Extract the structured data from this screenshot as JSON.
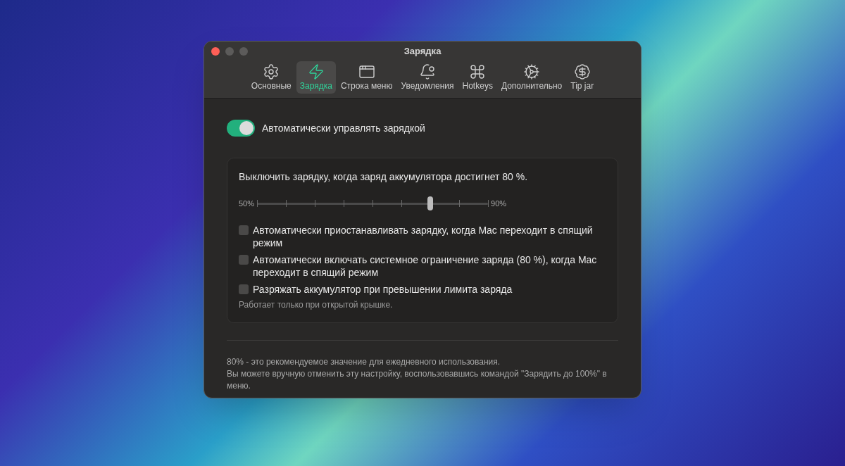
{
  "window": {
    "title": "Зарядка"
  },
  "tabs": [
    {
      "label": "Основные",
      "selected": false
    },
    {
      "label": "Зарядка",
      "selected": true
    },
    {
      "label": "Строка меню",
      "selected": false
    },
    {
      "label": "Уведомления",
      "selected": false
    },
    {
      "label": "Hotkeys",
      "selected": false
    },
    {
      "label": "Дополнительно",
      "selected": false
    },
    {
      "label": "Tip jar",
      "selected": false
    }
  ],
  "auto_manage": {
    "label": "Автоматически управлять зарядкой",
    "on": true
  },
  "limit": {
    "caption": "Выключить зарядку, когда заряд аккумулятора достигнет 80 %.",
    "min_label": "50%",
    "max_label": "90%",
    "level": 0.75
  },
  "options": [
    {
      "label": "Автоматически приостанавливать зарядку, когда Mac переходит в спящий режим",
      "checked": false
    },
    {
      "label": "Автоматически включать системное ограничение заряда (80 %), когда Mac переходит в спящий режим",
      "checked": false
    },
    {
      "label": "Разряжать аккумулятор при превышении лимита заряда",
      "checked": false
    }
  ],
  "options_note": "Работает только при открытой крышке.",
  "footer": [
    "80% - это рекомендуемое значение для ежедневного использования.",
    "Вы можете вручную отменить эту настройку, воспользовавшись командой \"Зарядить до 100%\" в меню."
  ]
}
